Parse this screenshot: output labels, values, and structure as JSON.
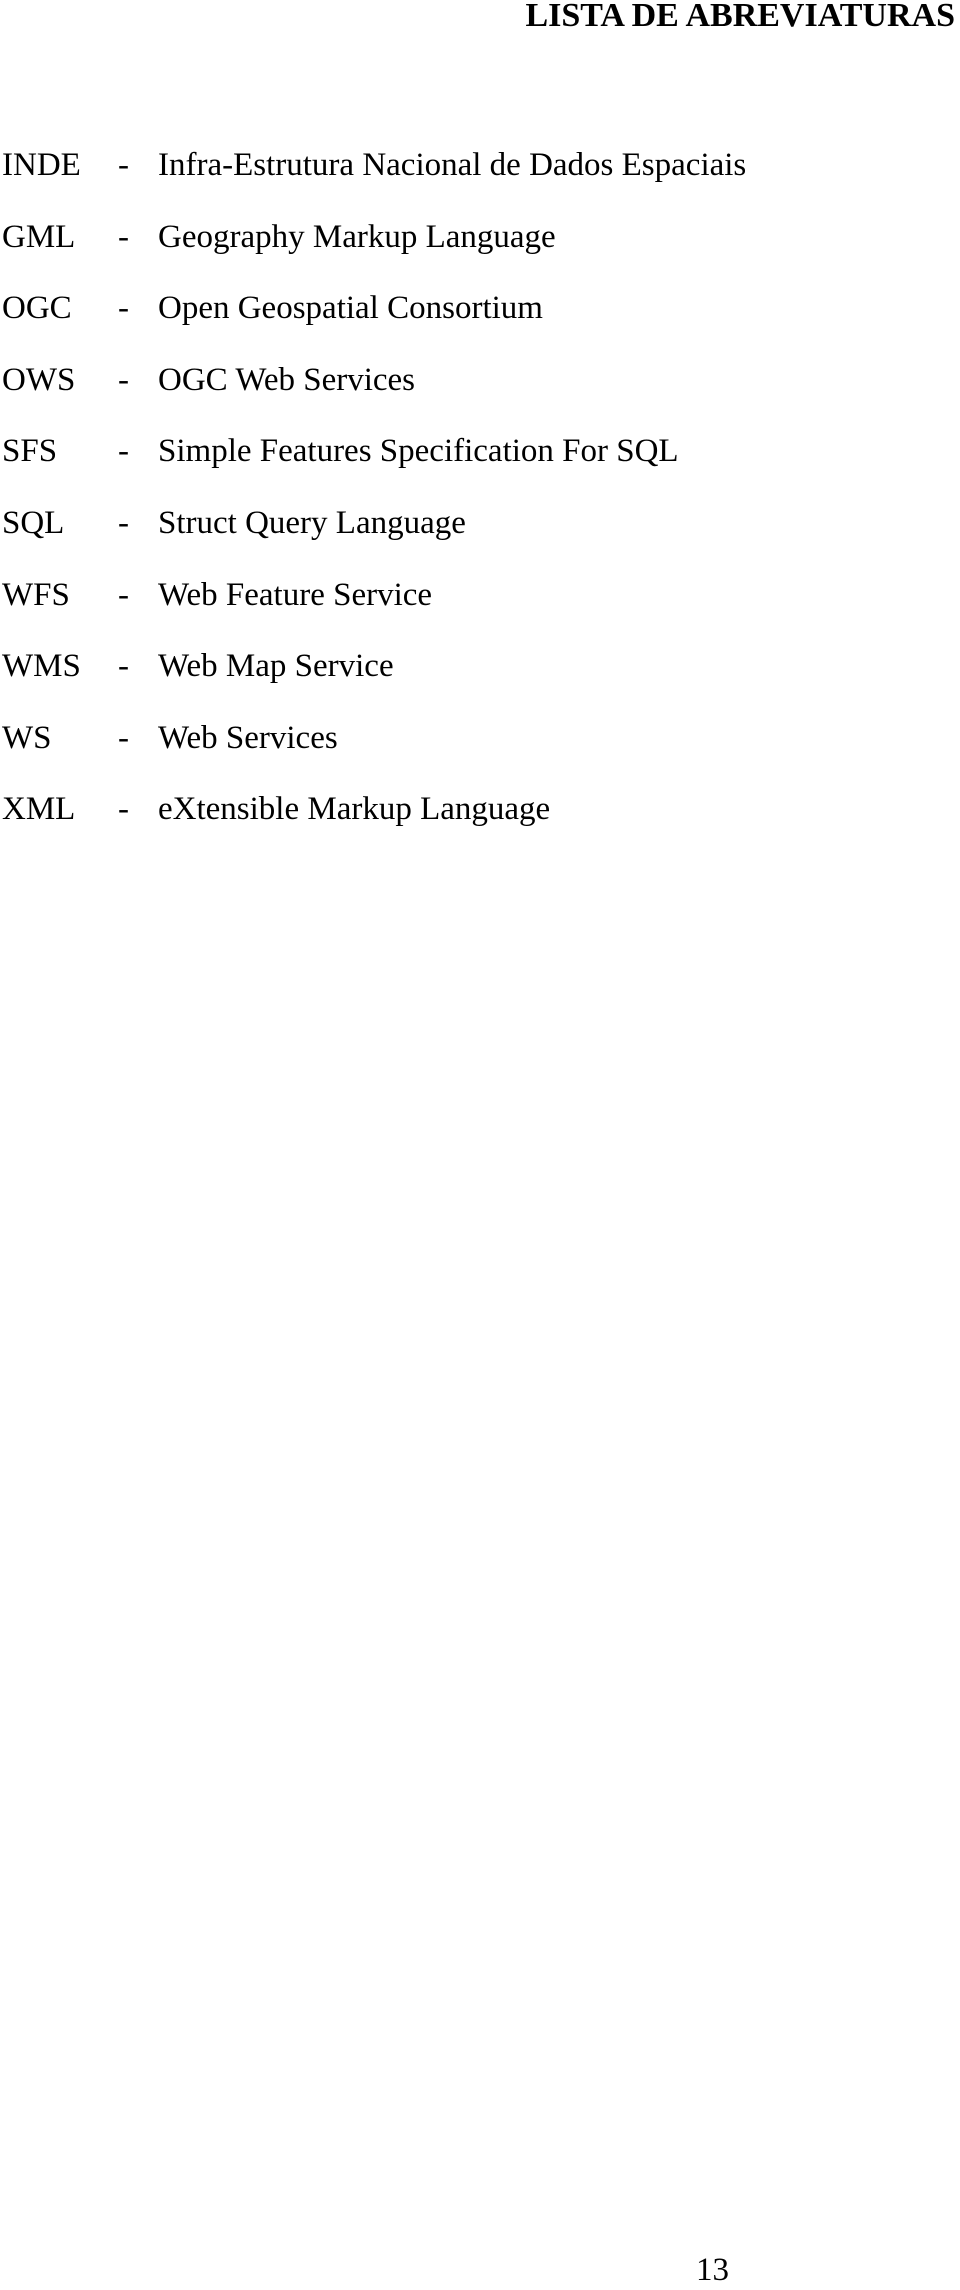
{
  "page": {
    "title": "LISTA DE ABREVIATURAS",
    "page_number": "13"
  },
  "abbreviations": [
    {
      "term": "INDE",
      "separator": "-",
      "definition": "Infra-Estrutura Nacional de Dados Espaciais"
    },
    {
      "term": "GML",
      "separator": "-",
      "definition": "Geography Markup Language"
    },
    {
      "term": "OGC",
      "separator": "-",
      "definition": "Open Geospatial Consortium"
    },
    {
      "term": "OWS",
      "separator": "-",
      "definition": "OGC Web Services"
    },
    {
      "term": "SFS",
      "separator": "-",
      "definition": "Simple Features Specification For SQL"
    },
    {
      "term": "SQL",
      "separator": "-",
      "definition": "Struct Query Language"
    },
    {
      "term": "WFS",
      "separator": "-",
      "definition": "Web Feature Service"
    },
    {
      "term": "WMS",
      "separator": "-",
      "definition": "Web Map Service"
    },
    {
      "term": "WS",
      "separator": "-",
      "definition": "Web Services"
    },
    {
      "term": "XML",
      "separator": "-",
      "definition": "eXtensible Markup Language"
    }
  ]
}
